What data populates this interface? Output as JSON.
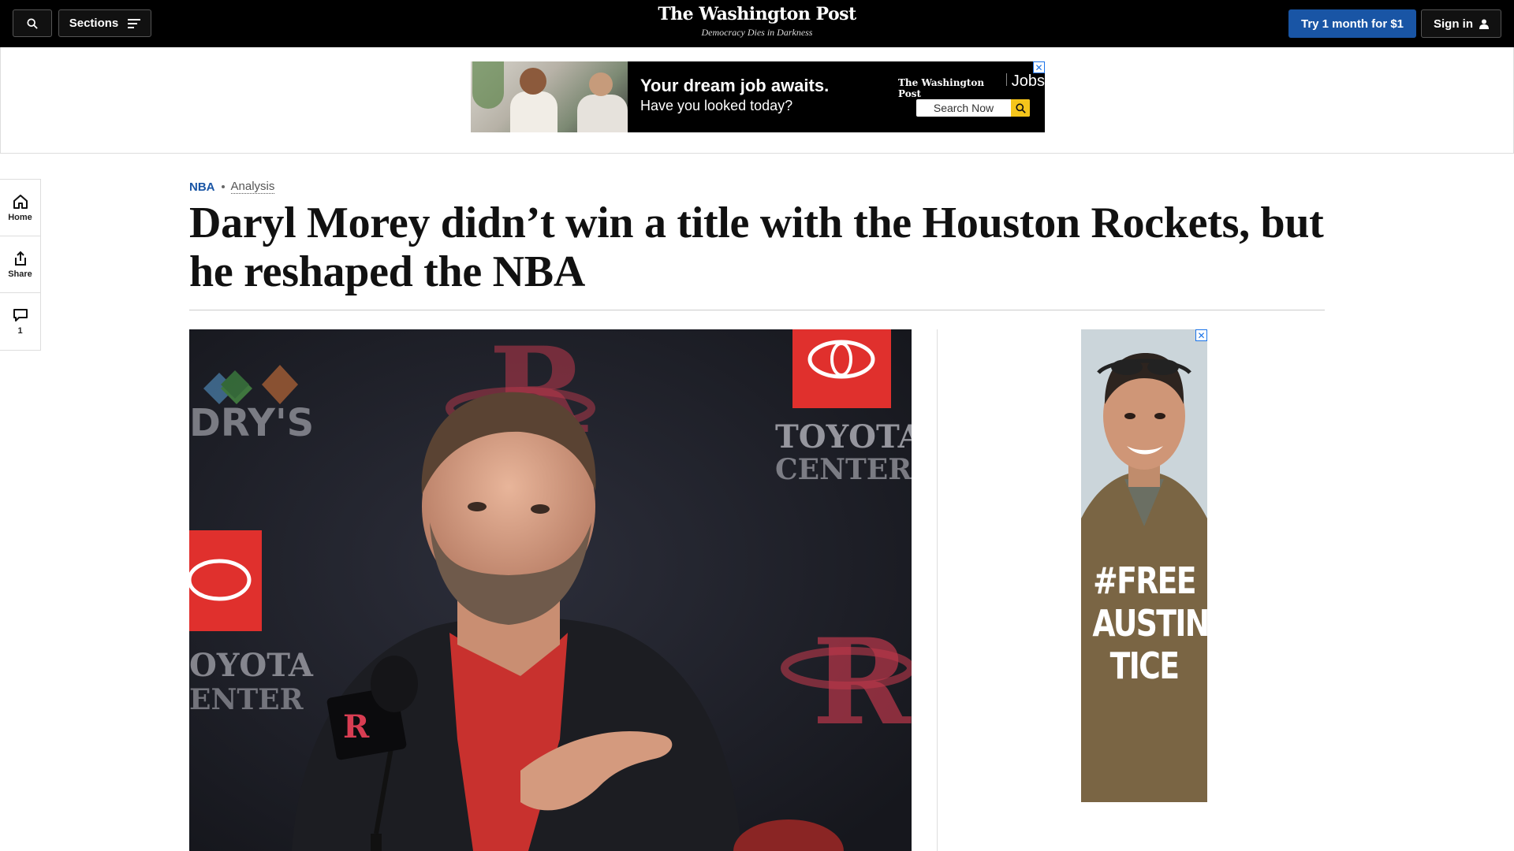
{
  "topnav": {
    "sections_label": "Sections",
    "logo": "The Washington Post",
    "tagline": "Democracy Dies in Darkness",
    "subscribe_label": "Try 1 month for $1",
    "signin_label": "Sign in",
    "accent_color": "#1955a5"
  },
  "jobs_ad": {
    "headline": "Your dream job awaits.",
    "subline": "Have you looked today?",
    "brand": "The Washington Post",
    "brand_suffix": "Jobs",
    "search_label": "Search Now",
    "close_label": "✕"
  },
  "rail": {
    "items": [
      {
        "label": "Home",
        "icon": "home-icon"
      },
      {
        "label": "Share",
        "icon": "share-icon"
      },
      {
        "label": "1",
        "icon": "comment-icon"
      }
    ]
  },
  "article": {
    "section": "NBA",
    "label": "Analysis",
    "headline": "Daryl Morey didn’t win a title with the Houston Rockets, but he reshaped the NBA"
  },
  "lead_photo": {
    "signage_left": "DRY'S",
    "signage_toyota": "TOYOTA",
    "signage_center": "CENTER",
    "signage_left2": "OYOTA",
    "signage_left3": "ENTER"
  },
  "side_ad": {
    "line1": "#FREE",
    "line2": "AUSTIN",
    "line3": "TICE",
    "close_label": "✕"
  }
}
